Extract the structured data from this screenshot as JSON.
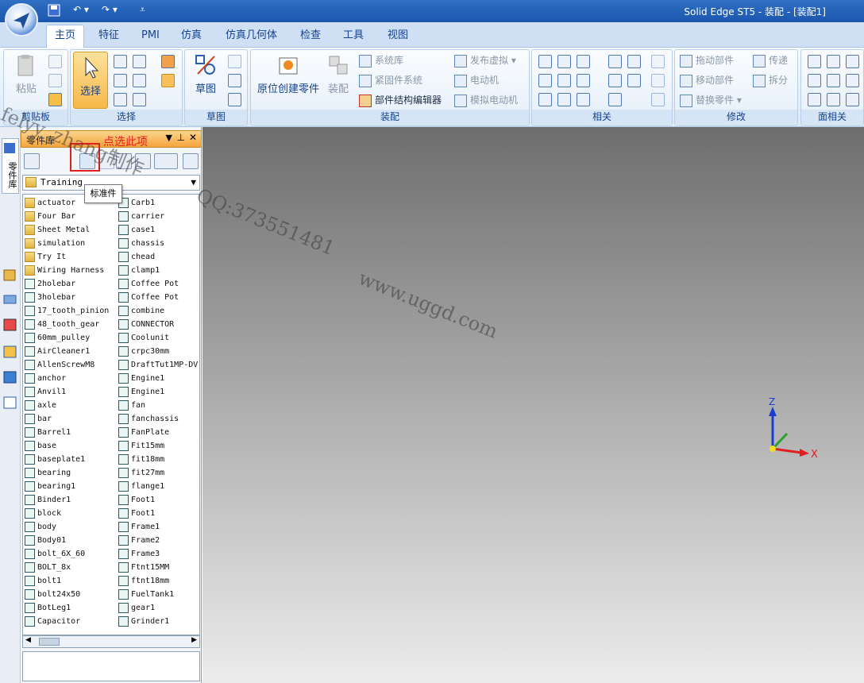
{
  "window": {
    "title": "Solid Edge ST5 - 装配 - [装配1]"
  },
  "tabs": [
    "主页",
    "特征",
    "PMI",
    "仿真",
    "仿真几何体",
    "检查",
    "工具",
    "视图"
  ],
  "ribbon": {
    "clipboard": {
      "label": "剪贴板",
      "paste": "粘贴"
    },
    "select": {
      "label": "选择",
      "button": "选择"
    },
    "sketch": {
      "label": "草图",
      "button": "草图"
    },
    "assemble": {
      "label": "装配",
      "place_part": "原位创建零件",
      "assemble_btn": "装配",
      "system_lib": "系统库",
      "fastener_system": "紧固件系统",
      "structure_editor": "部件结构编辑器",
      "publish_virtual": "发布虚拟",
      "motor": "电动机",
      "simulate_motor": "模拟电动机"
    },
    "relate": {
      "label": "相关"
    },
    "modify": {
      "label": "修改",
      "drag_part": "拖动部件",
      "move_part": "移动部件",
      "replace_part": "替换零件",
      "transfer": "传递",
      "disperse": "拆分"
    },
    "face_relate": {
      "label": "面相关"
    }
  },
  "panel": {
    "title": "零件库",
    "library": "Training",
    "tooltip": "标准件",
    "annotation": "点选此项"
  },
  "left_strip": {
    "tab_label": "零件库"
  },
  "list_left": [
    {
      "name": "actuator",
      "type": "folder"
    },
    {
      "name": "Four Bar",
      "type": "folder"
    },
    {
      "name": "Sheet Metal",
      "type": "folder"
    },
    {
      "name": "simulation",
      "type": "folder"
    },
    {
      "name": "Try It",
      "type": "folder"
    },
    {
      "name": "Wiring Harness",
      "type": "folder"
    },
    {
      "name": "2holebar",
      "type": "part"
    },
    {
      "name": "3holebar",
      "type": "part"
    },
    {
      "name": "17_tooth_pinion",
      "type": "part"
    },
    {
      "name": "48_tooth_gear",
      "type": "part"
    },
    {
      "name": "60mm_pulley",
      "type": "part"
    },
    {
      "name": "AirCleaner1",
      "type": "part"
    },
    {
      "name": "AllenScrewM8",
      "type": "part"
    },
    {
      "name": "anchor",
      "type": "part"
    },
    {
      "name": "Anvil1",
      "type": "part"
    },
    {
      "name": "axle",
      "type": "part"
    },
    {
      "name": "bar",
      "type": "part"
    },
    {
      "name": "Barrel1",
      "type": "part"
    },
    {
      "name": "base",
      "type": "part"
    },
    {
      "name": "baseplate1",
      "type": "part"
    },
    {
      "name": "bearing",
      "type": "part"
    },
    {
      "name": "bearing1",
      "type": "part"
    },
    {
      "name": "Binder1",
      "type": "part"
    },
    {
      "name": "block",
      "type": "part"
    },
    {
      "name": "body",
      "type": "part"
    },
    {
      "name": "Body01",
      "type": "part"
    },
    {
      "name": "bolt_6X_60",
      "type": "part"
    },
    {
      "name": "BOLT_8x",
      "type": "part"
    },
    {
      "name": "bolt1",
      "type": "part"
    },
    {
      "name": "bolt24x50",
      "type": "part"
    },
    {
      "name": "BotLeg1",
      "type": "part"
    },
    {
      "name": "Capacitor",
      "type": "part"
    }
  ],
  "list_right": [
    "Carb1",
    "carrier",
    "case1",
    "chassis",
    "chead",
    "clamp1",
    "Coffee Pot",
    "Coffee Pot",
    "combine",
    "CONNECTOR",
    "Coolunit",
    "crpc30mm",
    "DraftTut1MP-DV",
    "Engine1",
    "Engine1",
    "fan",
    "fanchassis",
    "FanPlate",
    "Fit15mm",
    "fit18mm",
    "fit27mm",
    "flange1",
    "Foot1",
    "Foot1",
    "Frame1",
    "Frame2",
    "Frame3",
    "Ftnt15MM",
    "ftnt18mm",
    "FuelTank1",
    "gear1",
    "Grinder1"
  ],
  "triad": {
    "x": "X",
    "z": "Z"
  },
  "watermarks": [
    "felyy_zhang制作",
    "QQ:373551481",
    "www.uggd.com"
  ],
  "colors": {
    "panel_header": "#f6a43c",
    "annotation": "#e02020",
    "axis_x": "#e02020",
    "axis_z": "#1a3fd0",
    "axis_y": "#2aa02a"
  }
}
